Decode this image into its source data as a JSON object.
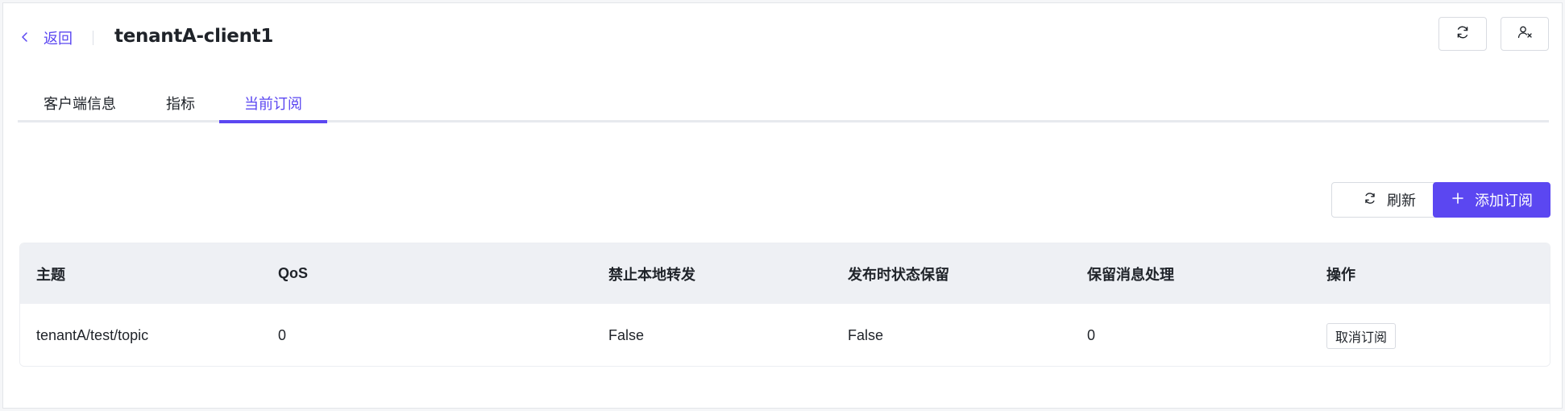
{
  "header": {
    "back_label": "返回",
    "title": "tenantA-client1",
    "icons": {
      "back": "chevron-left-icon",
      "refresh": "refresh-icon",
      "kick": "user-remove-icon"
    }
  },
  "tabs": [
    {
      "label": "客户端信息",
      "active": false
    },
    {
      "label": "指标",
      "active": false
    },
    {
      "label": "当前订阅",
      "active": true
    }
  ],
  "actions": {
    "refresh_label": "刷新",
    "add_label": "添加订阅",
    "icons": {
      "refresh": "refresh-icon",
      "add": "plus-icon"
    }
  },
  "table": {
    "columns": [
      "主题",
      "QoS",
      "禁止本地转发",
      "发布时状态保留",
      "保留消息处理",
      "操作"
    ],
    "rows": [
      {
        "topic": "tenantA/test/topic",
        "qos": "0",
        "no_local": "False",
        "retain_as_published": "False",
        "retain_handling": "0",
        "action_label": "取消订阅"
      }
    ]
  },
  "colors": {
    "accent": "#5b47f1",
    "header_bg": "#eef0f4",
    "border": "#d8dbe1",
    "text": "#1f2329"
  }
}
